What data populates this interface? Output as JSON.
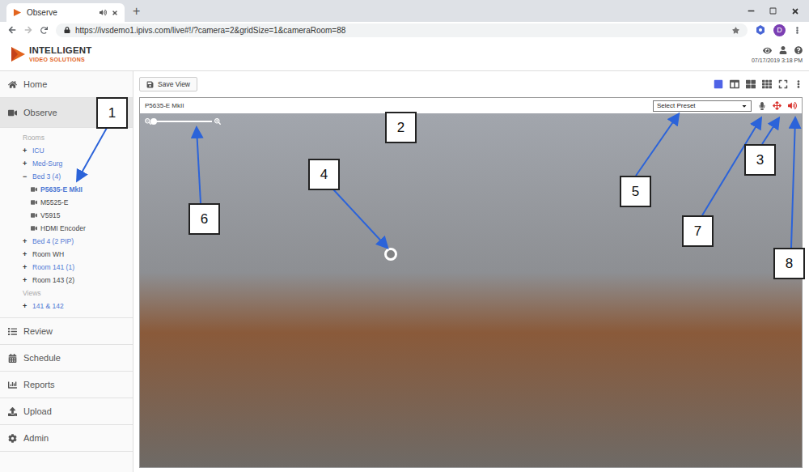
{
  "window": {
    "title": "Observe",
    "new_tab": "+"
  },
  "tabs": [
    {
      "label": "Observe",
      "selected": true,
      "audio": true
    }
  ],
  "address_bar": {
    "url": "https://ivsdemo1.ipivs.com/live#!/?camera=2&gridSize=1&cameraRoom=88",
    "profile": "D"
  },
  "header": {
    "logo_top": "INTELLIGENT",
    "logo_bottom": "VIDEO SOLUTIONS",
    "datetime": "07/17/2019 3:18 PM"
  },
  "sidebar": {
    "nav_top": [
      {
        "label": "Home",
        "icon": "home",
        "selected": false
      },
      {
        "label": "Observe",
        "icon": "observe",
        "selected": true
      }
    ],
    "tree": [
      {
        "kind": "heading",
        "label": "Rooms"
      },
      {
        "kind": "group",
        "sign": "+",
        "label": "ICU",
        "expanded": false,
        "color": "#4f78d4"
      },
      {
        "kind": "group",
        "sign": "+",
        "label": "Med-Surg",
        "expanded": false,
        "color": "#4f78d4"
      },
      {
        "kind": "group",
        "sign": "−",
        "label": "Bed 3 (4)",
        "expanded": true,
        "color": "#4f78d4"
      },
      {
        "kind": "camera",
        "label": "P5635-E MkII",
        "selected": true,
        "color": "#4f78d4"
      },
      {
        "kind": "camera",
        "label": "M5525-E",
        "selected": false,
        "color": "#444444"
      },
      {
        "kind": "camera",
        "label": "V5915",
        "selected": false,
        "color": "#444444"
      },
      {
        "kind": "camera",
        "label": "HDMI Encoder",
        "selected": false,
        "color": "#444444"
      },
      {
        "kind": "group",
        "sign": "+",
        "label": "Bed 4 (2 PIP)",
        "expanded": false,
        "color": "#4f78d4"
      },
      {
        "kind": "group",
        "sign": "+",
        "label": "Room WH",
        "expanded": false,
        "color": "#444444"
      },
      {
        "kind": "group",
        "sign": "+",
        "label": "Room 141 (1)",
        "expanded": false,
        "color": "#4f78d4"
      },
      {
        "kind": "group",
        "sign": "+",
        "label": "Room 143 (2)",
        "expanded": false,
        "color": "#444444"
      },
      {
        "kind": "heading",
        "label": "Views"
      },
      {
        "kind": "group",
        "sign": "+",
        "label": "141 & 142",
        "expanded": false,
        "color": "#4f78d4"
      }
    ],
    "nav_bottom": [
      {
        "label": "Review",
        "icon": "review",
        "selected": false
      },
      {
        "label": "Schedule",
        "icon": "schedule",
        "selected": false
      },
      {
        "label": "Reports",
        "icon": "reports",
        "selected": false
      },
      {
        "label": "Upload",
        "icon": "upload",
        "selected": false
      },
      {
        "label": "Admin",
        "icon": "admin",
        "selected": false
      }
    ]
  },
  "toolbar": {
    "save_button": "Save View",
    "layouts": [
      {
        "kind": "single",
        "selected": true
      },
      {
        "kind": "columns",
        "selected": false
      },
      {
        "kind": "grid4",
        "selected": false
      },
      {
        "kind": "grid9",
        "selected": false
      },
      {
        "kind": "fullscreen",
        "selected": false
      },
      {
        "kind": "more",
        "selected": false
      }
    ]
  },
  "camera": {
    "title": "P5635-E MkII",
    "preset_placeholder": "Select Preset",
    "ptz_active": true,
    "speaker_active": true,
    "zoom": {
      "level": 0
    }
  },
  "callouts": [
    {
      "number": "1"
    },
    {
      "number": "2"
    },
    {
      "number": "3"
    },
    {
      "number": "4"
    },
    {
      "number": "5"
    },
    {
      "number": "6"
    },
    {
      "number": "7"
    },
    {
      "number": "8"
    }
  ]
}
